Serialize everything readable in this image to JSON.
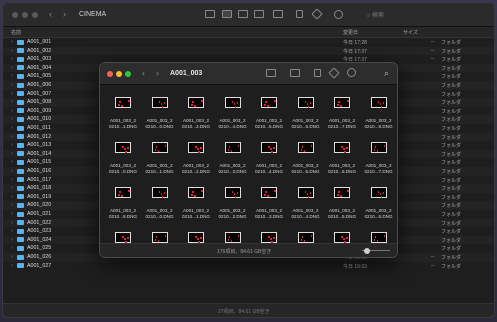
{
  "back_window": {
    "title": "CINEMA",
    "columns": {
      "name": "名前",
      "date": "変更日",
      "size": "サイズ"
    },
    "search_label": "検索",
    "rows": [
      {
        "name": "A001_001",
        "date": "今日 17:28",
        "size": "--",
        "kind": "フォルダ"
      },
      {
        "name": "A001_002",
        "date": "今日 17:37",
        "size": "--",
        "kind": "フォルダ"
      },
      {
        "name": "A001_003",
        "date": "今日 17:37",
        "size": "--",
        "kind": "フォルダ"
      },
      {
        "name": "A001_004",
        "date": "",
        "size": "",
        "kind": "フォルダ"
      },
      {
        "name": "A001_005",
        "date": "",
        "size": "",
        "kind": "フォルダ"
      },
      {
        "name": "A001_006",
        "date": "",
        "size": "",
        "kind": "フォルダ"
      },
      {
        "name": "A001_007",
        "date": "",
        "size": "",
        "kind": "フォルダ"
      },
      {
        "name": "A001_008",
        "date": "",
        "size": "",
        "kind": "フォルダ"
      },
      {
        "name": "A001_009",
        "date": "",
        "size": "",
        "kind": "フォルダ"
      },
      {
        "name": "A001_010",
        "date": "",
        "size": "",
        "kind": "フォルダ"
      },
      {
        "name": "A001_011",
        "date": "",
        "size": "",
        "kind": "フォルダ"
      },
      {
        "name": "A001_012",
        "date": "",
        "size": "",
        "kind": "フォルダ"
      },
      {
        "name": "A001_013",
        "date": "",
        "size": "",
        "kind": "フォルダ"
      },
      {
        "name": "A001_014",
        "date": "",
        "size": "",
        "kind": "フォルダ"
      },
      {
        "name": "A001_015",
        "date": "",
        "size": "",
        "kind": "フォルダ"
      },
      {
        "name": "A001_016",
        "date": "",
        "size": "",
        "kind": "フォルダ"
      },
      {
        "name": "A001_017",
        "date": "",
        "size": "",
        "kind": "フォルダ"
      },
      {
        "name": "A001_018",
        "date": "",
        "size": "",
        "kind": "フォルダ"
      },
      {
        "name": "A001_019",
        "date": "",
        "size": "",
        "kind": "フォルダ"
      },
      {
        "name": "A001_020",
        "date": "",
        "size": "",
        "kind": "フォルダ"
      },
      {
        "name": "A001_021",
        "date": "",
        "size": "",
        "kind": "フォルダ"
      },
      {
        "name": "A001_022",
        "date": "",
        "size": "",
        "kind": "フォルダ"
      },
      {
        "name": "A001_023",
        "date": "",
        "size": "",
        "kind": "フォルダ"
      },
      {
        "name": "A001_024",
        "date": "",
        "size": "",
        "kind": "フォルダ"
      },
      {
        "name": "A001_025",
        "date": "",
        "size": "",
        "kind": "フォルダ"
      },
      {
        "name": "A001_026",
        "date": "今日 18:59",
        "size": "--",
        "kind": "フォルダ"
      },
      {
        "name": "A001_027",
        "date": "今日 19:03",
        "size": "--",
        "kind": "フォルダ"
      }
    ],
    "status": "27項目、84.61 GB空き"
  },
  "front_window": {
    "title": "A001_003",
    "status": "176項目、84.61 GB空き",
    "files": [
      {
        "l1": "A001_003_2",
        "l2": "0210...1.DNG"
      },
      {
        "l1": "A001_003_2",
        "l2": "0210...0.DNG"
      },
      {
        "l1": "A001_003_2",
        "l2": "0210...3.DNG"
      },
      {
        "l1": "A001_003_2",
        "l2": "0210...4.DNG"
      },
      {
        "l1": "A001_003_2",
        "l2": "0210...5.DNG"
      },
      {
        "l1": "A001_003_2",
        "l2": "0210...6.DNG"
      },
      {
        "l1": "A001_003_2",
        "l2": "0210...7.DNG"
      },
      {
        "l1": "A001_003_2",
        "l2": "0210...8.DNG"
      },
      {
        "l1": "A001_003_2",
        "l2": "0210...9.DNG"
      },
      {
        "l1": "A001_003_2",
        "l2": "0210...0.DNG"
      },
      {
        "l1": "A001_003_2",
        "l2": "0210...1.DNG"
      },
      {
        "l1": "A001_003_2",
        "l2": "0210...2.DNG"
      },
      {
        "l1": "A001_003_2",
        "l2": "0210...3.DNG"
      },
      {
        "l1": "A001_003_2",
        "l2": "0210...4.DNG"
      },
      {
        "l1": "A001_003_2",
        "l2": "0210...5.DNG"
      },
      {
        "l1": "A001_003_2",
        "l2": "0210...6.DNG"
      },
      {
        "l1": "A001_003_2",
        "l2": "0210...7.DNG"
      },
      {
        "l1": "A001_003_2",
        "l2": "0210...8.DNG"
      },
      {
        "l1": "A001_003_2",
        "l2": "0210...9.DNG"
      },
      {
        "l1": "A001_003_2",
        "l2": "0210...0.DNG"
      },
      {
        "l1": "A001_003_2",
        "l2": "0210...1.DNG"
      },
      {
        "l1": "A001_003_2",
        "l2": "0210...2.DNG"
      },
      {
        "l1": "A001_003_2",
        "l2": "0210...3.DNG"
      },
      {
        "l1": "A001_003_2",
        "l2": "0210...4.DNG"
      },
      {
        "l1": "A001_003_2",
        "l2": "0210...5.DNG"
      },
      {
        "l1": "A001_003_2",
        "l2": "0210...6.DNG"
      },
      {
        "l1": "A001_003_2",
        "l2": "0210...7.DNG"
      },
      {
        "l1": "",
        "l2": ""
      },
      {
        "l1": "",
        "l2": ""
      },
      {
        "l1": "",
        "l2": ""
      },
      {
        "l1": "",
        "l2": ""
      },
      {
        "l1": "",
        "l2": ""
      },
      {
        "l1": "",
        "l2": ""
      },
      {
        "l1": "",
        "l2": ""
      },
      {
        "l1": "",
        "l2": ""
      },
      {
        "l1": "",
        "l2": ""
      }
    ]
  },
  "colors": {
    "folder": "#5ab3f0",
    "close": "#ff5f57",
    "minimize": "#febc2e",
    "zoom": "#28c840"
  }
}
